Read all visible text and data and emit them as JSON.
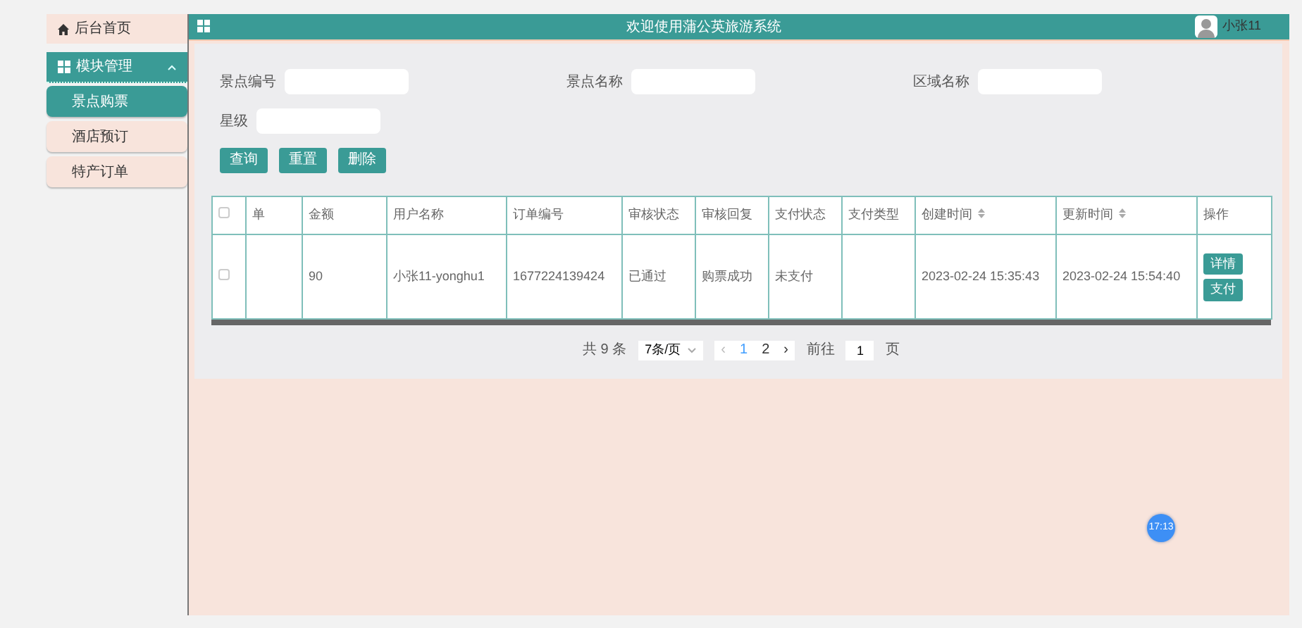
{
  "sidebar": {
    "home": {
      "label": "后台首页"
    },
    "groups": [
      {
        "label": "模块管理",
        "expanded": true,
        "children": [
          {
            "label": "景点购票",
            "selected": true
          },
          {
            "label": "酒店预订",
            "selected": false
          },
          {
            "label": "特产订单",
            "selected": false
          }
        ]
      }
    ]
  },
  "header": {
    "title": "欢迎使用蒲公英旅游系统",
    "user": {
      "name": "小张11"
    }
  },
  "search": {
    "fields": [
      {
        "label": "景点编号"
      },
      {
        "label": "景点名称"
      },
      {
        "label": "区域名称"
      },
      {
        "label": "星级"
      }
    ],
    "buttons": [
      "查询",
      "重置",
      "删除"
    ]
  },
  "table": {
    "header_checked": false,
    "columns": [
      {
        "label": "单",
        "sortable": false
      },
      {
        "label": "金额",
        "sortable": false
      },
      {
        "label": "用户名称",
        "sortable": false
      },
      {
        "label": "订单编号",
        "sortable": false
      },
      {
        "label": "审核状态",
        "sortable": false
      },
      {
        "label": "审核回复",
        "sortable": false
      },
      {
        "label": "支付状态",
        "sortable": false
      },
      {
        "label": "支付类型",
        "sortable": false
      },
      {
        "label": "创建时间",
        "sortable": true
      },
      {
        "label": "更新时间",
        "sortable": true
      },
      {
        "label": "操作",
        "sortable": false
      }
    ],
    "rows": [
      {
        "checked": false,
        "cells": [
          "",
          "90",
          "小张11-yonghu1",
          "1677224139424",
          "已通过",
          "购票成功",
          "未支付",
          "",
          "2023-02-24 15:35:43",
          "2023-02-24 15:54:40"
        ],
        "actions": [
          "详情",
          "支付"
        ]
      }
    ]
  },
  "pagination": {
    "total": "共 9 条",
    "page_size": "7条/页",
    "prev": "‹",
    "next": "›",
    "pages": [
      {
        "label": "1",
        "selected": true
      },
      {
        "label": "2",
        "selected": false
      }
    ],
    "goto_label": "前往",
    "goto_value": "1",
    "page_suffix": "页"
  },
  "timer_badge": "17:13"
}
